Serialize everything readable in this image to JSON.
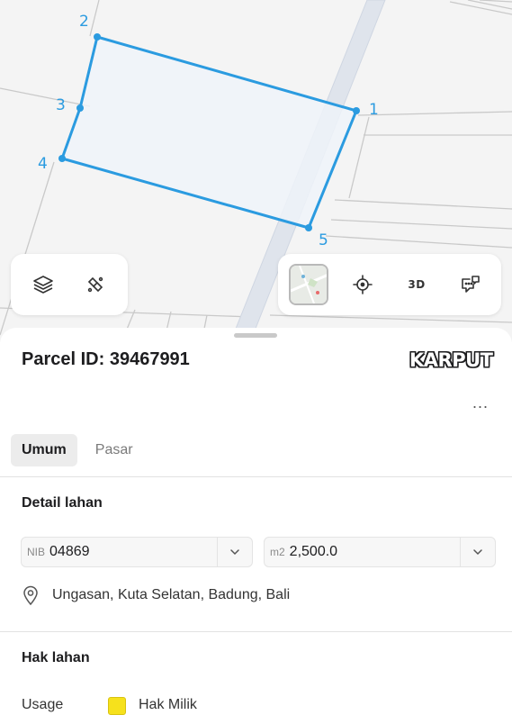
{
  "map": {
    "parcel_vertex_labels": [
      "1",
      "2",
      "3",
      "4",
      "5"
    ],
    "colors": {
      "parcel_outline": "#2b9be0",
      "parcel_fill": "#eef3f9",
      "road": "#dfe4ec",
      "background": "#f4f4f4"
    }
  },
  "toolbar": {
    "left_buttons": [
      {
        "icon": "layers-icon"
      },
      {
        "icon": "measure-path-icon"
      }
    ],
    "right_buttons": [
      {
        "icon": "map-thumbnail-icon"
      },
      {
        "icon": "locate-crosshair-icon"
      },
      {
        "icon": "3d-icon",
        "label": "3D"
      },
      {
        "icon": "feedback-chat-icon"
      }
    ]
  },
  "sheet": {
    "parcel_title": "Parcel ID: 39467991",
    "brand": "KARPUT",
    "more_icon": "more-dots-icon",
    "more_label": "...",
    "tabs": [
      {
        "label": "Umum",
        "active": true
      },
      {
        "label": "Pasar",
        "active": false
      }
    ],
    "detail": {
      "title": "Detail lahan",
      "nib": {
        "prefix": "NIB",
        "value": "04869"
      },
      "area": {
        "prefix": "m2",
        "value": "2,500.0"
      },
      "address_icon": "location-pin-icon",
      "address": "Ungasan, Kuta Selatan, Badung, Bali"
    },
    "rights": {
      "title": "Hak lahan",
      "usage_label": "Usage",
      "usage_value": "Hak Milik",
      "usage_color": "#f6e11c"
    }
  }
}
